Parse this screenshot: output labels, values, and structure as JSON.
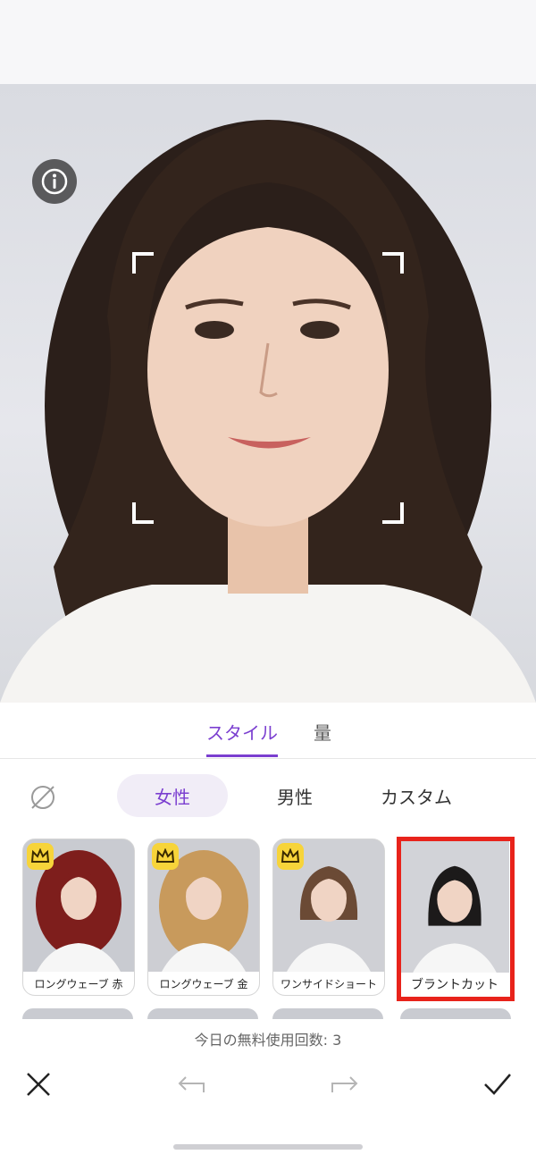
{
  "tabs": {
    "style": "スタイル",
    "amount": "量"
  },
  "categories": {
    "female": "女性",
    "male": "男性",
    "custom": "カスタム"
  },
  "styles": [
    {
      "label": "ロングウェーブ 赤",
      "premium": true
    },
    {
      "label": "ロングウェーブ 金",
      "premium": true
    },
    {
      "label": "ワンサイドショート",
      "premium": true
    },
    {
      "label": "ブラントカット",
      "premium": false,
      "selected": true
    }
  ],
  "usage_text": "今日の無料使用回数: 3",
  "icons": {
    "info": "info-icon",
    "compare": "compare-icon",
    "none": "no-style-icon",
    "crown": "crown-icon",
    "close": "close-icon",
    "undo": "undo-icon",
    "redo": "redo-icon",
    "confirm": "check-icon"
  },
  "colors": {
    "accent": "#7b3fd0",
    "highlight": "#e8231b",
    "crown": "#f7d43a"
  }
}
